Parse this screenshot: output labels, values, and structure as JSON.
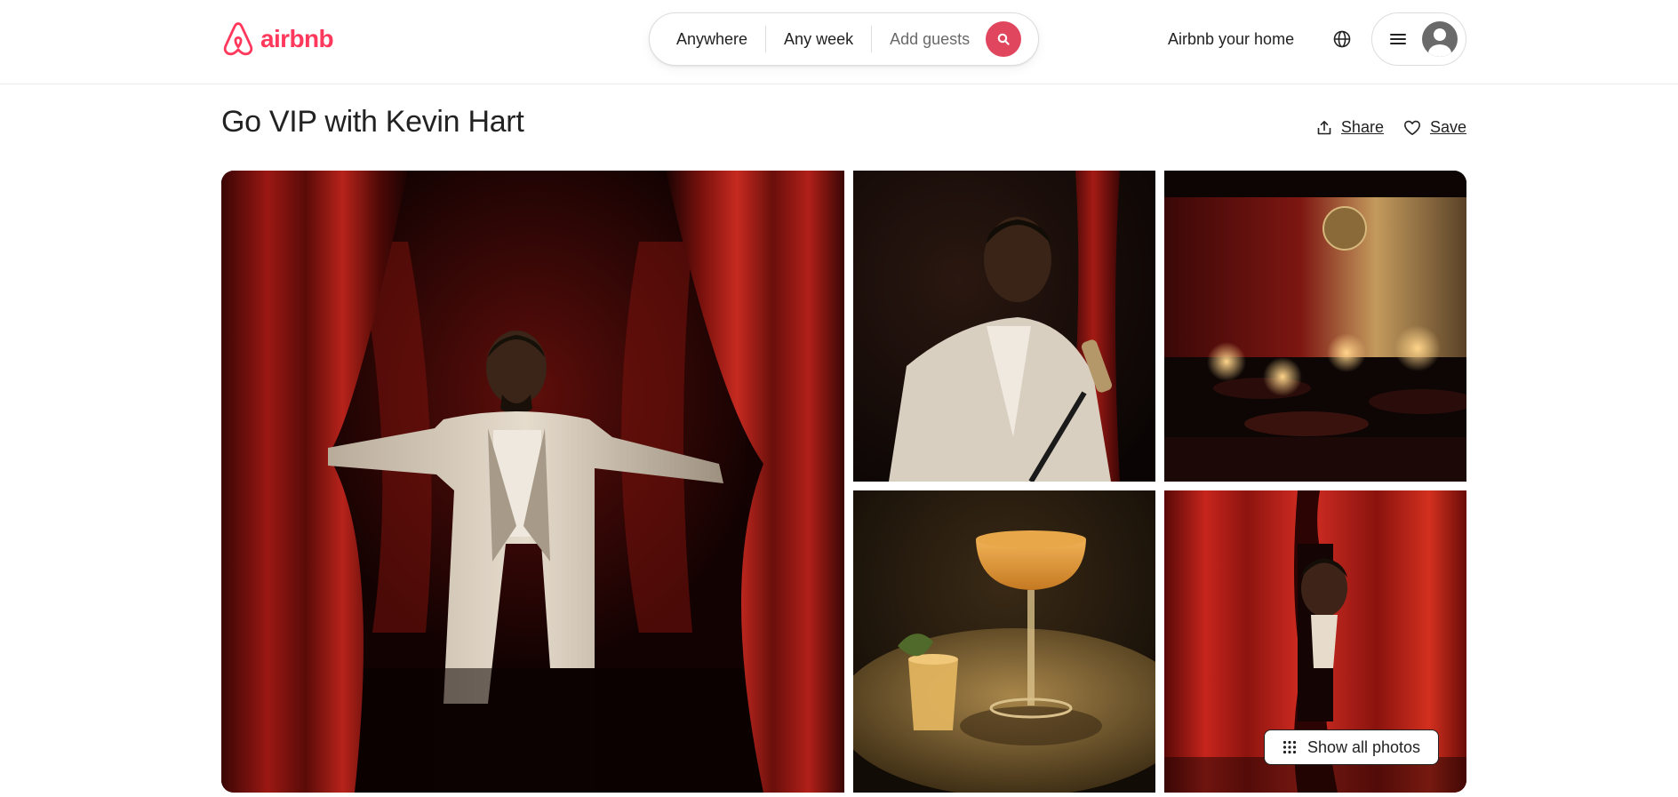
{
  "header": {
    "logo_text": "airbnb",
    "brand_color": "#ff385c",
    "search": {
      "location": "Anywhere",
      "dates": "Any week",
      "guests": "Add guests",
      "button_icon": "search-icon"
    },
    "host_link": "Airbnb your home",
    "globe_icon": "globe-icon",
    "menu_icon": "hamburger-icon",
    "avatar_icon": "user-avatar-icon"
  },
  "listing": {
    "title": "Go VIP with Kevin Hart",
    "share_label": "Share",
    "save_label": "Save"
  },
  "gallery": {
    "photos": [
      "Man in cream suit parting red stage curtains",
      "Man in cream suit holding a microphone",
      "Dim lounge with red curtains and table lamps",
      "Cocktail coupe and short glass with lime",
      "Man peeking out between red curtains"
    ],
    "show_all_label": "Show all photos"
  }
}
